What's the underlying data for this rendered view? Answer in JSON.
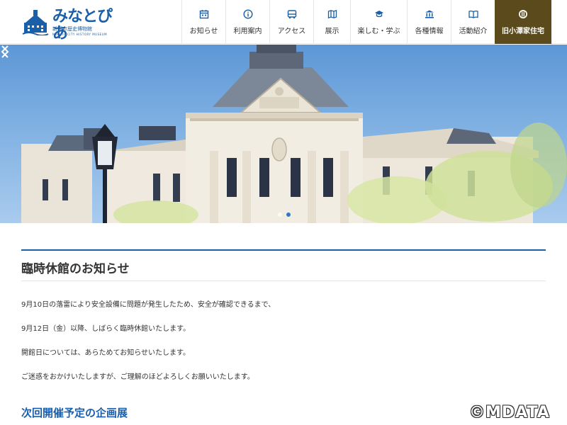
{
  "header": {
    "logo_title": "みなとぴあ",
    "logo_subtitle": "新潟市歴史博物館",
    "logo_subtitle_en": "NIIGATA CITY HISTORY MUSEUM"
  },
  "nav": [
    {
      "label": "お知らせ",
      "icon": "calendar-icon"
    },
    {
      "label": "利用案内",
      "icon": "info-icon"
    },
    {
      "label": "アクセス",
      "icon": "bus-icon"
    },
    {
      "label": "展示",
      "icon": "map-icon"
    },
    {
      "label": "楽しむ・学ぶ",
      "icon": "graduation-cap-icon"
    },
    {
      "label": "各種情報",
      "icon": "building-icon"
    },
    {
      "label": "活動紹介",
      "icon": "book-icon"
    },
    {
      "label": "旧小澤家住宅",
      "icon": "crest-icon"
    }
  ],
  "hero": {
    "slides": 2,
    "active_slide": 1
  },
  "notice": {
    "title": "臨時休館のお知らせ",
    "paragraphs": [
      "9月10日の落雷により安全設備に問題が発生したため、安全が確認できるまで、",
      "9月12日（金）以降、しばらく臨時休館いたします。",
      "開館日については、あらためてお知らせいたします。",
      "ご迷惑をおかけいたしますが、ご理解のほどよろしくお願いいたします。"
    ]
  },
  "next_section": {
    "title": "次回開催予定の企画展"
  },
  "watermark": "©MDATA",
  "colors": {
    "brand_blue": "#1b5fa8",
    "special_nav_bg": "#5a4a1c"
  }
}
